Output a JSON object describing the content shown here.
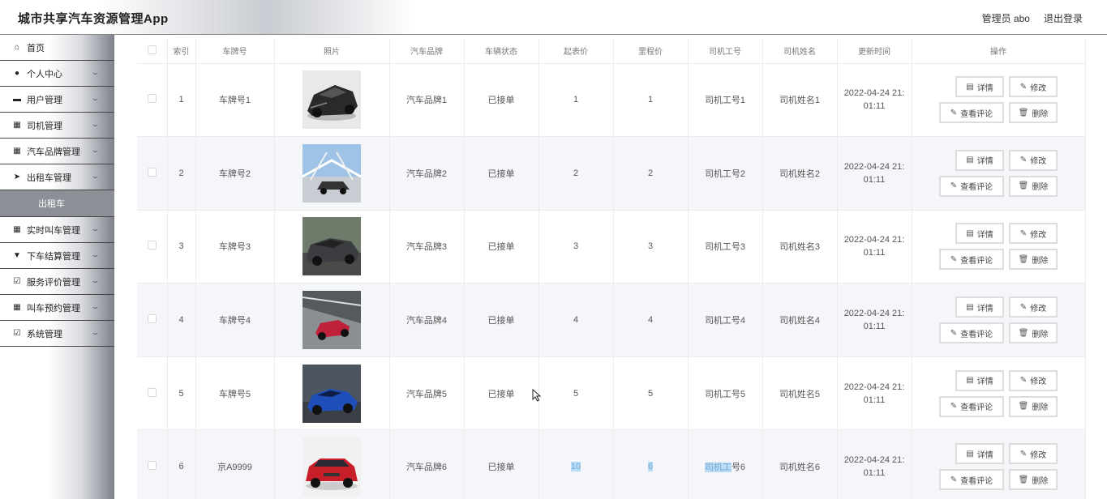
{
  "header": {
    "app_title": "城市共享汽车资源管理App",
    "user_label": "管理员 abo",
    "logout_label": "退出登录"
  },
  "sidebar": {
    "items": [
      {
        "label": "首页",
        "icon": "home-icon",
        "glyph": "⌂",
        "expandable": false
      },
      {
        "label": "个人中心",
        "icon": "user-icon",
        "glyph": "●",
        "expandable": true
      },
      {
        "label": "用户管理",
        "icon": "briefcase-icon",
        "glyph": "▬",
        "expandable": true
      },
      {
        "label": "司机管理",
        "icon": "grid-icon",
        "glyph": "▦",
        "expandable": true
      },
      {
        "label": "汽车品牌管理",
        "icon": "grid-icon",
        "glyph": "▦",
        "expandable": true
      },
      {
        "label": "出租车管理",
        "icon": "send-icon",
        "glyph": "➤",
        "expandable": true
      }
    ],
    "active_submenu": "出租车",
    "items_after": [
      {
        "label": "实时叫车管理",
        "icon": "grid-icon",
        "glyph": "▦",
        "expandable": true
      },
      {
        "label": "下车结算管理",
        "icon": "pay-icon",
        "glyph": "▼",
        "expandable": true
      },
      {
        "label": "服务评价管理",
        "icon": "check-square-icon",
        "glyph": "☑",
        "expandable": true
      },
      {
        "label": "叫车预约管理",
        "icon": "grid-icon",
        "glyph": "▦",
        "expandable": true
      },
      {
        "label": "系统管理",
        "icon": "clipboard-icon",
        "glyph": "☑",
        "expandable": true
      }
    ]
  },
  "table": {
    "columns": [
      "索引",
      "车牌号",
      "照片",
      "汽车品牌",
      "车辆状态",
      "起表价",
      "里程价",
      "司机工号",
      "司机姓名",
      "更新时间",
      "操作"
    ],
    "actions": {
      "detail": "详情",
      "edit": "修改",
      "comment": "查看评论",
      "delete": "删除"
    },
    "rows": [
      {
        "index": "1",
        "plate": "车牌号1",
        "photo": "photo-supercar-black",
        "brand": "汽车品牌1",
        "status": "已接单",
        "start_price": "1",
        "mile_price": "1",
        "driver_no": "司机工号1",
        "driver_name": "司机姓名1",
        "time_line1": "2022-04-24 21:",
        "time_line2": "01:11"
      },
      {
        "index": "2",
        "plate": "车牌号2",
        "photo": "photo-car-on-bridge",
        "brand": "汽车品牌2",
        "status": "已接单",
        "start_price": "2",
        "mile_price": "2",
        "driver_no": "司机工号2",
        "driver_name": "司机姓名2",
        "time_line1": "2022-04-24 21:",
        "time_line2": "01:11"
      },
      {
        "index": "3",
        "plate": "车牌号3",
        "photo": "photo-muscle-car-gray",
        "brand": "汽车品牌3",
        "status": "已接单",
        "start_price": "3",
        "mile_price": "3",
        "driver_no": "司机工号3",
        "driver_name": "司机姓名3",
        "time_line1": "2022-04-24 21:",
        "time_line2": "01:11"
      },
      {
        "index": "4",
        "plate": "车牌号4",
        "photo": "photo-red-sports-car",
        "brand": "汽车品牌4",
        "status": "已接单",
        "start_price": "4",
        "mile_price": "4",
        "driver_no": "司机工号4",
        "driver_name": "司机姓名4",
        "time_line1": "2022-04-24 21:",
        "time_line2": "01:11"
      },
      {
        "index": "5",
        "plate": "车牌号5",
        "photo": "photo-blue-coupe",
        "brand": "汽车品牌5",
        "status": "已接单",
        "start_price": "5",
        "mile_price": "5",
        "driver_no": "司机工号5",
        "driver_name": "司机姓名5",
        "time_line1": "2022-04-24 21:",
        "time_line2": "01:11"
      },
      {
        "index": "6",
        "plate": "京A9999",
        "photo": "photo-red-suv",
        "brand": "汽车品牌6",
        "status": "已接单",
        "start_price": "10",
        "mile_price": "6",
        "driver_no_sel": "司机工",
        "driver_no_rest": "号6",
        "driver_name": "司机姓名6",
        "time_line1": "2022-04-24 21:",
        "time_line2": "01:11"
      }
    ]
  },
  "colors": {
    "sidebar_submenu_bg": "#8c8f96",
    "row_alt_bg": "#f5f6fa",
    "selection_bg": "#b9dcf7"
  }
}
